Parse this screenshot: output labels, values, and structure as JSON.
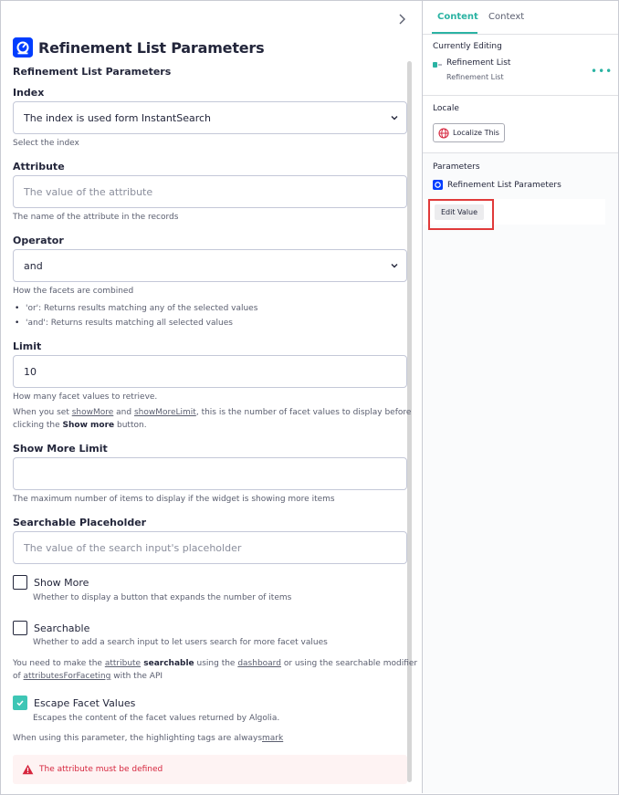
{
  "header": {
    "title": "Refinement List Parameters",
    "subtitle": "Refinement List Parameters"
  },
  "form": {
    "index": {
      "label": "Index",
      "value": "The index is used form InstantSearch",
      "help": "Select the index"
    },
    "attribute": {
      "label": "Attribute",
      "placeholder": "The value of the attribute",
      "help": "The name of the attribute in the records"
    },
    "operator": {
      "label": "Operator",
      "value": "and",
      "help": "How the facets are combined",
      "bullets": [
        "'or': Returns results matching any of the selected values",
        "'and': Returns results matching all selected values"
      ]
    },
    "limit": {
      "label": "Limit",
      "value": "10",
      "help": "How many facet values to retrieve.",
      "help2": {
        "prefix": "When you set ",
        "link1": "showMore",
        "mid1": " and ",
        "link2": "showMoreLimit",
        "suffix": ", this is the number of facet values to display before",
        "line2_prefix": "clicking the ",
        "bold": "Show more",
        "line2_suffix": " button."
      }
    },
    "show_more_limit": {
      "label": "Show More Limit",
      "value": "",
      "help": "The maximum number of items to display if the widget is showing more items"
    },
    "searchable_placeholder": {
      "label": "Searchable Placeholder",
      "placeholder": "The value of the search input's placeholder"
    },
    "show_more": {
      "label": "Show More",
      "checked": false,
      "help": "Whether to display a button that expands the number of items"
    },
    "searchable": {
      "label": "Searchable",
      "checked": false,
      "help": "Whether to add a search input to let users search for more facet values",
      "note": {
        "p1": "You need to make the ",
        "link1": "attribute",
        "bold": " searchable",
        "p2": " using the ",
        "link2": "dashboard",
        "p3": " or using the searchable modifier",
        "line2_prefix": "of ",
        "link3": "attributesForFaceting",
        "line2_suffix": " with the API"
      }
    },
    "escape_facet_values": {
      "label": "Escape Facet Values",
      "checked": true,
      "help": "Escapes the content of the facet values returned by Algolia.",
      "note": {
        "text": "When using this parameter, the highlighting tags are always",
        "link": "mark"
      }
    }
  },
  "error": {
    "message": "The attribute must be defined"
  },
  "sidebar": {
    "tabs": [
      {
        "label": "Content",
        "active": true
      },
      {
        "label": "Context",
        "active": false
      }
    ],
    "currently_editing": {
      "title": "Currently Editing",
      "name": "Refinement List",
      "sub": "Refinement List"
    },
    "locale": {
      "title": "Locale",
      "button": "Localize This"
    },
    "parameters": {
      "title": "Parameters",
      "item": "Refinement List Parameters",
      "edit_button": "Edit Value"
    }
  },
  "colors": {
    "accent": "#2bb3a3",
    "error": "#d6263e",
    "highlight": "#e03a3a",
    "brand_blue": "#003dff"
  },
  "icons": [
    "chevron-right-icon",
    "algolia-logo-icon",
    "chevron-down-icon",
    "check-icon",
    "warning-icon",
    "component-icon",
    "more-dots-icon",
    "globe-icon"
  ]
}
